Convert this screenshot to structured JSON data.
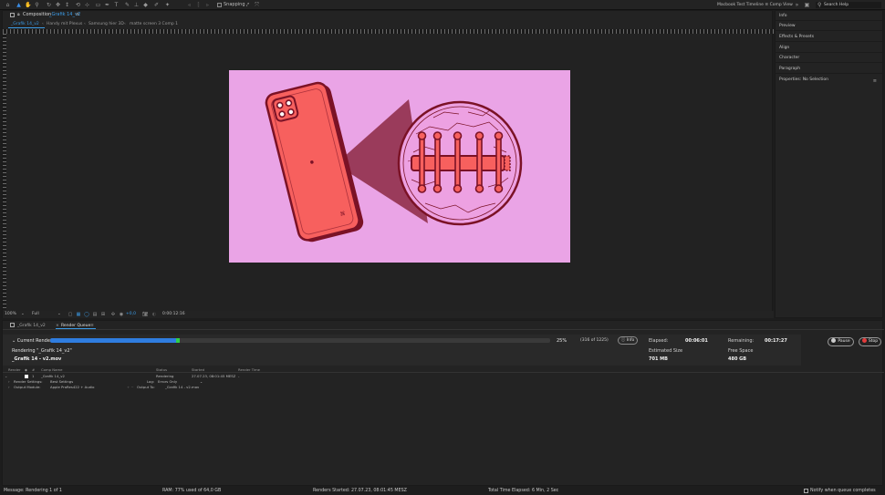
{
  "toolbar": {
    "tools": [
      "home-icon",
      "selection-tool-icon",
      "hand-tool-icon",
      "zoom-tool-icon",
      "orbit-tool-icon",
      "pan-tool-icon",
      "dolly-tool-icon",
      "rotate-tool-icon",
      "anchor-tool-icon",
      "rectangle-tool-icon",
      "pen-tool-icon",
      "type-tool-icon",
      "brush-tool-icon",
      "clone-stamp-icon",
      "eraser-icon",
      "roto-brush-icon",
      "puppet-pin-icon"
    ],
    "snapping_label": "Snapping",
    "workspace_title": "Macbook Test Timeline ≡ Comp View",
    "search_placeholder": "Search Help"
  },
  "composition": {
    "panel_label": "Composition",
    "comp_name": "_Grafik 14_v2",
    "flowchart": [
      "_Grafik 14_v2",
      "Handy mit Plexus",
      "Samsung hier 3D",
      "matte screen 3 Comp 1"
    ],
    "footer": {
      "zoom": "100%",
      "resolution": "Full",
      "exposure": "+0,0",
      "timecode": "0:00:12:16"
    },
    "colors": {
      "background": "#eaa4e6",
      "phone": "#f7605e",
      "outline": "#7b1226",
      "lens_fill": "#eda1e2"
    }
  },
  "right_panel": {
    "items": [
      "Info",
      "Preview",
      "Effects & Presets",
      "Align",
      "Character",
      "Paragraph",
      "Properties: No Selection"
    ]
  },
  "render_queue": {
    "tabs": [
      "_Grafik 14_v2",
      "Render Queue"
    ],
    "current_render_label": "Current Render",
    "progress_fraction": 0.26,
    "percent": "25%",
    "frames": "(316 of 1225)",
    "info_label": "Info",
    "rendering_name": "Rendering \"_Grafik 14_v2\"",
    "output_file": "_Grafik 14 - v2.mov",
    "elapsed_label": "Elapsed:",
    "elapsed_value": "00:06:01",
    "remaining_label": "Remaining:",
    "remaining_value": "00:17:27",
    "est_size_label": "Estimated Size",
    "est_size_value": "701 MB",
    "free_space_label": "Free Space",
    "free_space_value": "480 GB",
    "pause_label": "Pause",
    "stop_label": "Stop",
    "columns": [
      "Render",
      "#",
      "Comp Name",
      "Status",
      "Started",
      "Render Time"
    ],
    "row": {
      "index": "1",
      "comp_name": "_Grafik 14_v2",
      "status": "Rendering",
      "started": "27.07.23, 08:01:45 MESZ",
      "render_time": "-"
    },
    "render_settings_label": "Render Settings:",
    "render_settings_value": "Best Settings",
    "log_label": "Log:",
    "log_value": "Errors Only",
    "output_module_label": "Output Module:",
    "output_module_value": "Apple ProRes422 + Audio",
    "output_to_label": "Output To:",
    "output_to_value": "_Grafik 14 - v2.mov"
  },
  "status_bar": {
    "message": "Message: Rendering 1 of 1",
    "ram": "RAM: 77% used of 64,0 GB",
    "renders_started": "Renders Started: 27.07.23, 08:01:45 MESZ",
    "total_elapsed": "Total Time Elapsed: 6 Min, 2 Sec",
    "notify_label": "Notify when queue completes"
  }
}
